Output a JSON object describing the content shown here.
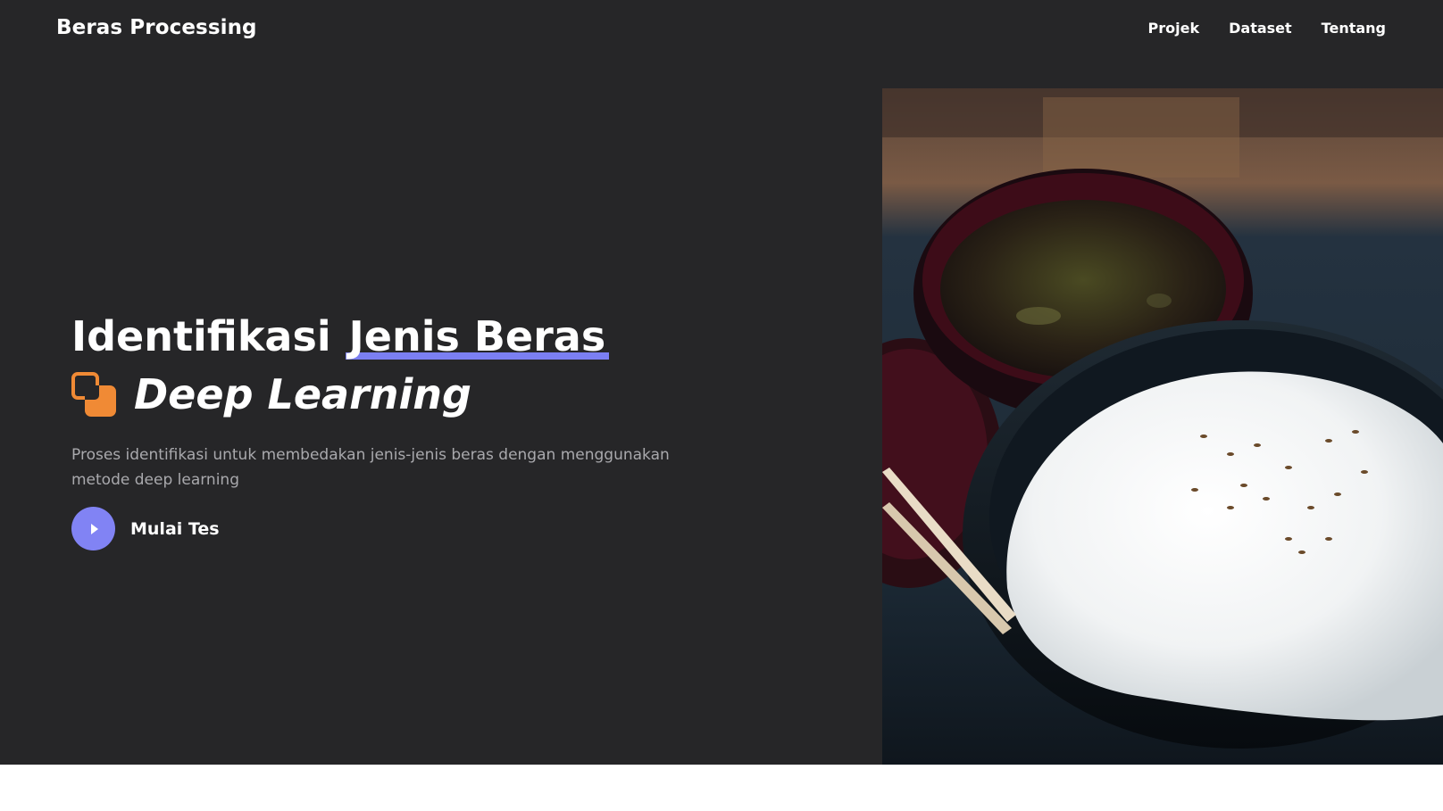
{
  "nav": {
    "brand": "Beras Processing",
    "links": [
      "Projek",
      "Dataset",
      "Tentang"
    ]
  },
  "hero": {
    "headline_prefix": "Identifikasi",
    "headline_highlight": "Jenis Beras",
    "subtitle": "Deep Learning",
    "description": "Proses identifikasi untuk membedakan jenis-jenis beras dengan menggunakan metode deep learning",
    "cta_label": "Mulai Tes",
    "image": "rice-bowl-photo"
  },
  "icons": {
    "subtitle_icon": "layers-icon",
    "cta_icon": "play-icon"
  },
  "colors": {
    "background": "#262628",
    "accent": "#8183f4",
    "orange": "#f08a35",
    "description": "#a9a9ad"
  }
}
